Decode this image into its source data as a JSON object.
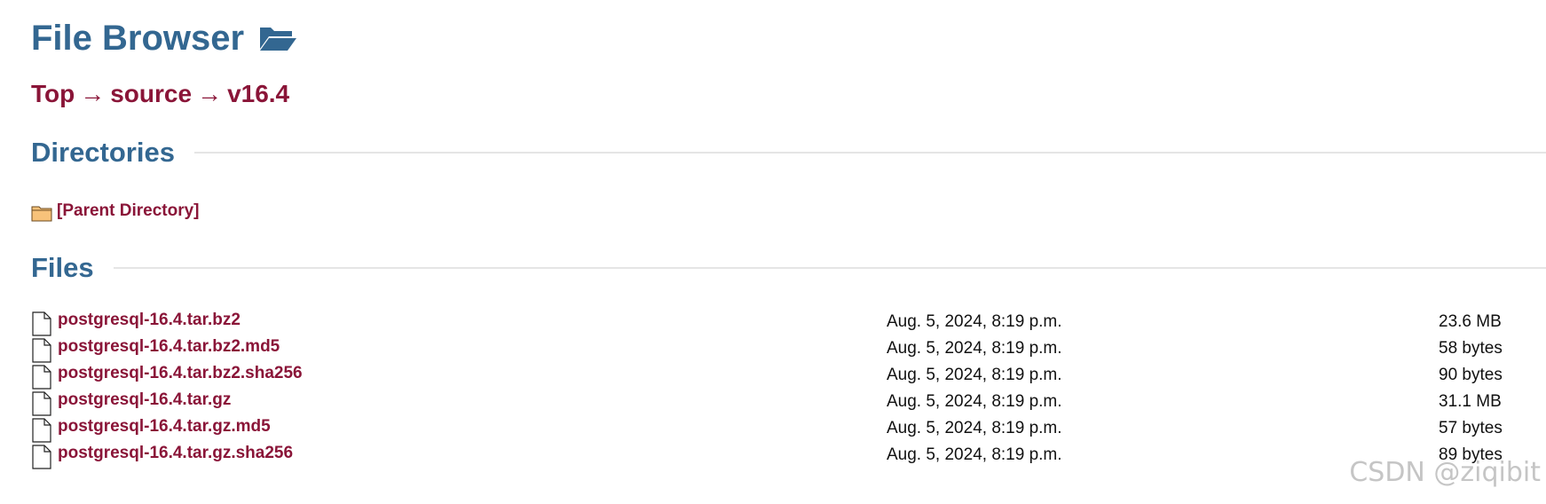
{
  "page": {
    "title": "File Browser",
    "title_icon": "folder-open-icon"
  },
  "breadcrumb": {
    "items": [
      "Top",
      "source",
      "v16.4"
    ],
    "separator": "→"
  },
  "sections": {
    "directories_title": "Directories",
    "files_title": "Files"
  },
  "directories": [
    {
      "label": "[Parent Directory]",
      "icon": "folder-icon"
    }
  ],
  "files": [
    {
      "name": "postgresql-16.4.tar.bz2",
      "date": "Aug. 5, 2024, 8:19 p.m.",
      "size": "23.6 MB"
    },
    {
      "name": "postgresql-16.4.tar.bz2.md5",
      "date": "Aug. 5, 2024, 8:19 p.m.",
      "size": "58 bytes"
    },
    {
      "name": "postgresql-16.4.tar.bz2.sha256",
      "date": "Aug. 5, 2024, 8:19 p.m.",
      "size": "90 bytes"
    },
    {
      "name": "postgresql-16.4.tar.gz",
      "date": "Aug. 5, 2024, 8:19 p.m.",
      "size": "31.1 MB"
    },
    {
      "name": "postgresql-16.4.tar.gz.md5",
      "date": "Aug. 5, 2024, 8:19 p.m.",
      "size": "57 bytes"
    },
    {
      "name": "postgresql-16.4.tar.gz.sha256",
      "date": "Aug. 5, 2024, 8:19 p.m.",
      "size": "89 bytes"
    }
  ],
  "watermark": "CSDN @ziqibit",
  "colors": {
    "heading": "#336791",
    "link": "#8a1538",
    "rule": "#e5e5e5"
  }
}
